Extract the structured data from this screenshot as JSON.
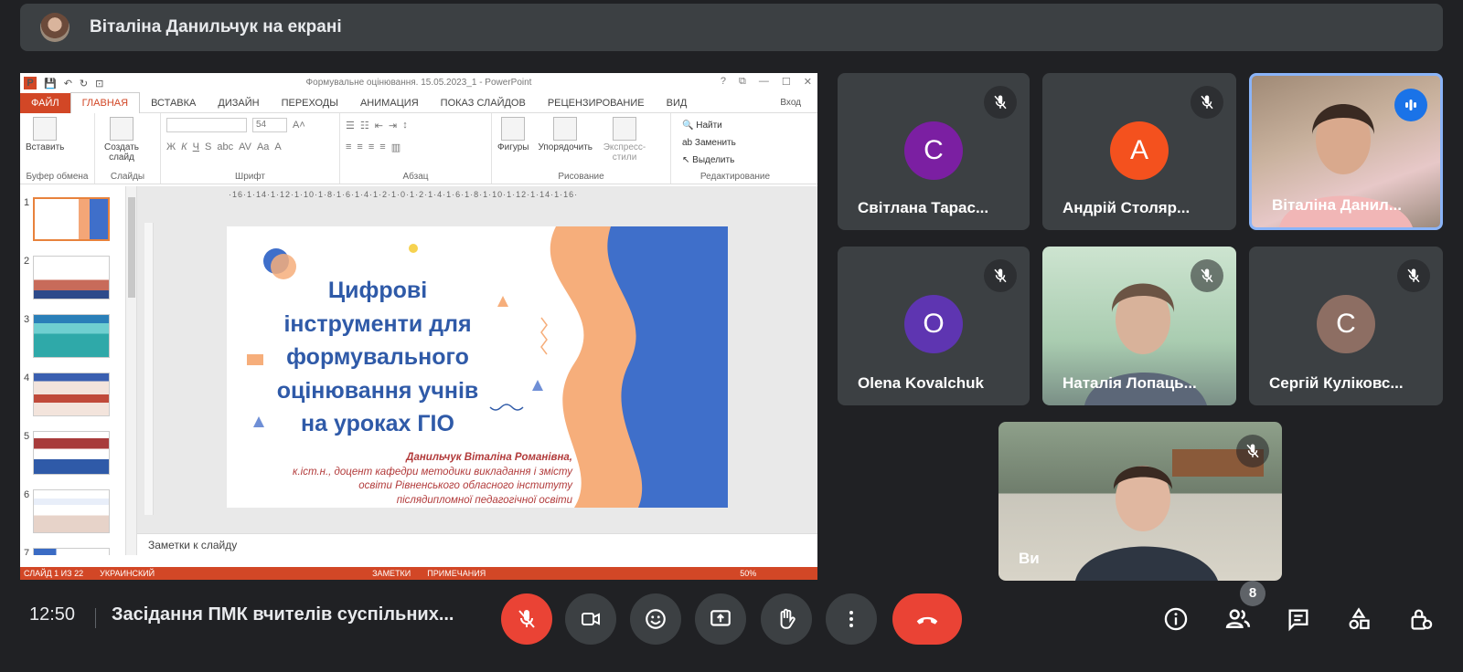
{
  "banner": {
    "presenter_text": "Віталіна Данильчук на екрані"
  },
  "ppt": {
    "title": "Формувальне оцінювання. 15.05.2023_1 - PowerPoint",
    "window_controls": [
      "?",
      "⧉",
      "—",
      "☐",
      "✕"
    ],
    "tabs": [
      "ФАЙЛ",
      "ГЛАВНАЯ",
      "ВСТАВКА",
      "ДИЗАЙН",
      "ПЕРЕХОДЫ",
      "АНИМАЦИЯ",
      "ПОКАЗ СЛАЙДОВ",
      "РЕЦЕНЗИРОВАНИЕ",
      "ВИД"
    ],
    "signin": "Вход",
    "ribbon": {
      "clipboard_label": "Буфер обмена",
      "paste": "Вставить",
      "slides_label": "Слайды",
      "new_slide": "Создать слайд",
      "font_label": "Шрифт",
      "font_size": "54",
      "paragraph_label": "Абзац",
      "drawing_label": "Рисование",
      "shapes": "Фигуры",
      "arrange": "Упорядочить",
      "quick_styles": "Экспресс-стили",
      "editing_label": "Редактирование",
      "find": "Найти",
      "replace": "Заменить",
      "select": "Выделить"
    },
    "ruler_text": "·16·1·14·1·12·1·10·1·8·1·6·1·4·1·2·1·0·1·2·1·4·1·6·1·8·1·10·1·12·1·14·1·16·",
    "thumb_numbers": [
      "1",
      "2",
      "3",
      "4",
      "5",
      "6",
      "7"
    ],
    "slide": {
      "title_lines": [
        "Цифрові",
        "інструменти для",
        "формувального",
        "оцінювання учнів",
        "на уроках ГІО"
      ],
      "author_name": "Данильчук Віталіна Романівна,",
      "author_lines": [
        "к.іст.н., доцент кафедри методики викладання і змісту",
        "освіти Рівненського обласного інституту",
        "післядипломної педагогічної освіти"
      ]
    },
    "notes_placeholder": "Заметки к слайду",
    "status": {
      "slide": "СЛАЙД 1 ИЗ 22",
      "lang": "УКРАИНСКИЙ",
      "notes": "ЗАМЕТКИ",
      "comments": "ПРИМЕЧАНИЯ",
      "zoom": "50%"
    }
  },
  "participants": [
    {
      "name": "Світлана Тарас...",
      "initial": "С",
      "color": "#7b1fa2"
    },
    {
      "name": "Андрій Столяр...",
      "initial": "А",
      "color": "#f4511e"
    },
    {
      "name": "Віталіна Данил..."
    },
    {
      "name": "Olena Kovalchuk",
      "initial": "O",
      "color": "#5e35b1"
    },
    {
      "name": "Наталія Лопаць..."
    },
    {
      "name": "Сергій Куліковс...",
      "initial": "С",
      "color": "#8d6e63"
    },
    {
      "name": "Ви"
    }
  ],
  "bottom": {
    "time": "12:50",
    "meeting_title": "Засідання ПМК вчителів суспільних...",
    "participants_count": "8"
  },
  "icons": [
    "mic-off-icon",
    "videocam-icon",
    "emoji-icon",
    "present-icon",
    "hand-icon",
    "more-icon",
    "call-end-icon",
    "info-icon",
    "people-icon",
    "chat-icon",
    "activities-icon",
    "host-controls-icon"
  ]
}
